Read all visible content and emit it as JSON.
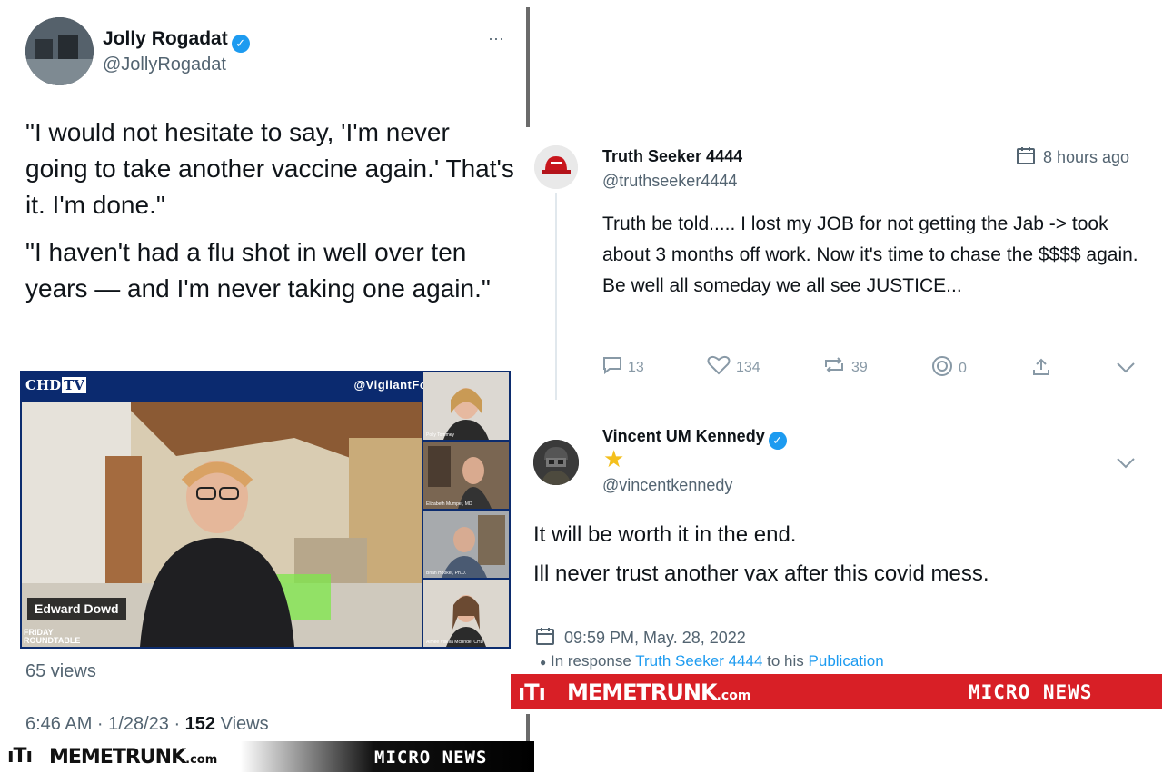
{
  "left_tweet": {
    "name": "Jolly Rogadat",
    "handle": "@JollyRogadat",
    "more": "···",
    "paragraphs": [
      "\"I would not hesitate to say, 'I'm never going to take another vaccine again.' That's it. I'm done.\"",
      "\"I haven't had a flu shot in well over ten years — and I'm never taking one again.\""
    ],
    "video": {
      "channel_logo": "CHD",
      "channel_logo_tv": "TV",
      "watermark": "@VigilantFox",
      "speaker_name": "Edward Dowd",
      "show_logo_top": "FRIDAY",
      "show_logo_bottom": "ROUNDTABLE",
      "panelists": [
        "Polly Tommey",
        "Elizabeth Mumper, MD",
        "Brian Hooker, Ph.D.",
        "Aimee Villella McBride, CHD"
      ]
    },
    "views": "65 views",
    "timestamp": "6:46 AM · 1/28/23 · ",
    "view_count": "152",
    "view_suffix": " Views"
  },
  "brand_left": {
    "name": "MEMETRUNK",
    "tld": ".com",
    "tag": "MICRO NEWS"
  },
  "right_post_1": {
    "name": "Truth Seeker 4444",
    "handle": "@truthseeker4444",
    "time": "8 hours ago",
    "text": "Truth be told..... I lost my JOB for not getting the Jab -> took about 3 months off work. Now it's time to chase the $$$$ again. Be well all someday we all see JUSTICE...",
    "actions": {
      "replies": "13",
      "likes": "134",
      "reposts": "39",
      "other": "0"
    }
  },
  "right_post_2": {
    "name": "Vincent UM Kennedy",
    "star": "★",
    "handle": "@vincentkennedy",
    "line1": "It will be worth it in the end.",
    "line2": "Ill never trust another vax after this covid mess.",
    "date": "09:59 PM, May. 28, 2022",
    "response_prefix": "In response ",
    "response_user": "Truth Seeker 4444",
    "response_mid": " to his ",
    "response_link": "Publication"
  },
  "brand_right": {
    "name": "MEMETRUNK",
    "tld": ".com",
    "tag": "MICRO NEWS"
  },
  "colors": {
    "accent": "#1d9bf0",
    "brand_red": "#d81f26",
    "text": "#0f1419",
    "muted": "#536471"
  }
}
